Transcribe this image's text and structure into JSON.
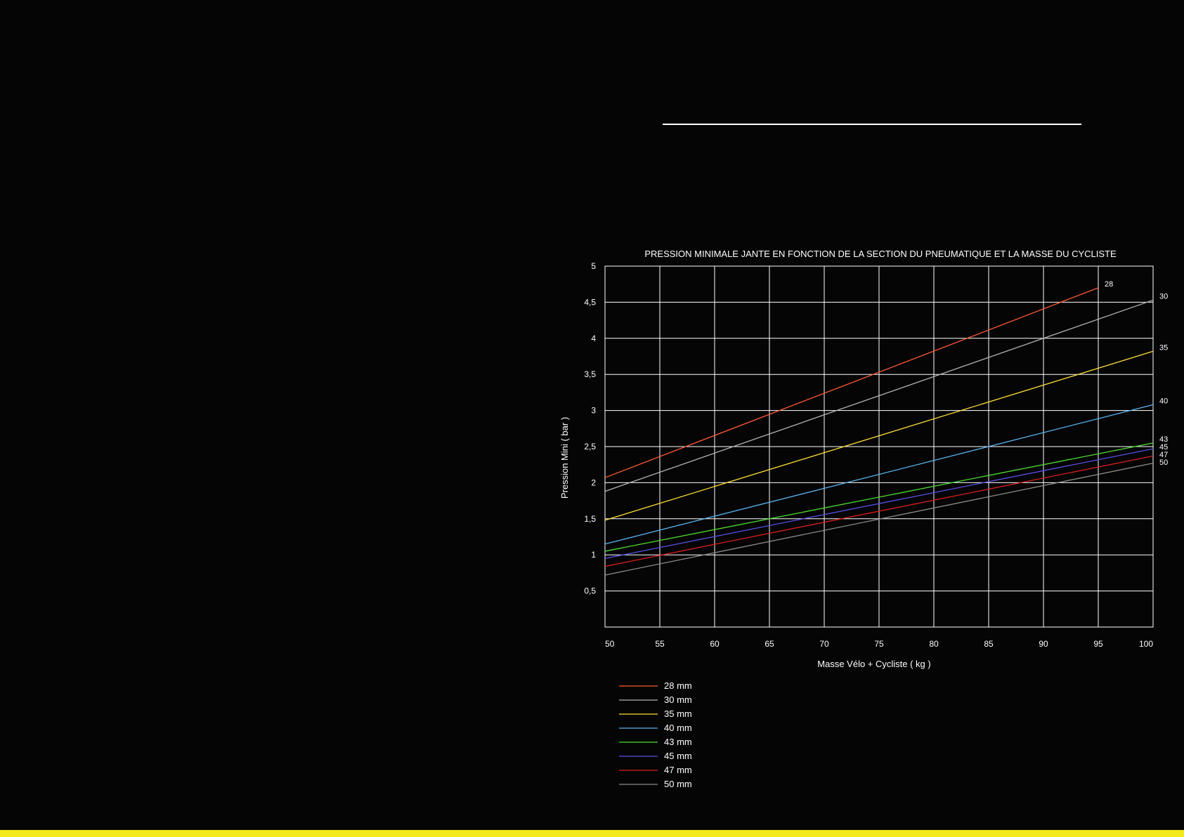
{
  "chart_data": {
    "type": "line",
    "title": "PRESSION MINIMALE JANTE EN FONCTION DE LA SECTION DU PNEUMATIQUE ET LA MASSE DU CYCLISTE",
    "xlabel": "Masse Vélo + Cycliste ( kg )",
    "ylabel": "Pression Mini ( bar )",
    "xlim": [
      50,
      100
    ],
    "ylim": [
      0,
      5
    ],
    "x_ticks": [
      {
        "value": 50,
        "label": "50"
      },
      {
        "value": 55,
        "label": "55"
      },
      {
        "value": 60,
        "label": "60"
      },
      {
        "value": 65,
        "label": "65"
      },
      {
        "value": 70,
        "label": "70"
      },
      {
        "value": 75,
        "label": "75"
      },
      {
        "value": 80,
        "label": "80"
      },
      {
        "value": 85,
        "label": "85"
      },
      {
        "value": 90,
        "label": "90"
      },
      {
        "value": 95,
        "label": "95"
      },
      {
        "value": 100,
        "label": "100"
      }
    ],
    "y_ticks": [
      {
        "value": 0.5,
        "label": "0,5"
      },
      {
        "value": 1,
        "label": "1"
      },
      {
        "value": 1.5,
        "label": "1,5"
      },
      {
        "value": 2,
        "label": "2"
      },
      {
        "value": 2.5,
        "label": "2,5"
      },
      {
        "value": 3,
        "label": "3"
      },
      {
        "value": 3.5,
        "label": "3,5"
      },
      {
        "value": 4,
        "label": "4"
      },
      {
        "value": 4.5,
        "label": "4,5"
      },
      {
        "value": 5,
        "label": "5"
      }
    ],
    "grid": true,
    "legend_position": "bottom-left",
    "series": [
      {
        "name": "28 mm",
        "end_label": "28",
        "color": "#ff5a36",
        "x": [
          50,
          95
        ],
        "y": [
          2.07,
          4.7
        ]
      },
      {
        "name": "30 mm",
        "end_label": "30",
        "color": "#b4b4b4",
        "x": [
          50,
          100
        ],
        "y": [
          1.88,
          4.53
        ]
      },
      {
        "name": "35 mm",
        "end_label": "35",
        "color": "#ffe03a",
        "x": [
          50,
          100
        ],
        "y": [
          1.48,
          3.82
        ]
      },
      {
        "name": "40 mm",
        "end_label": "40",
        "color": "#5ab4f0",
        "x": [
          50,
          100
        ],
        "y": [
          1.15,
          3.08
        ]
      },
      {
        "name": "43 mm",
        "end_label": "43",
        "color": "#4edc32",
        "x": [
          50,
          100
        ],
        "y": [
          1.05,
          2.55
        ]
      },
      {
        "name": "45 mm",
        "end_label": "45",
        "color": "#5a4ee6",
        "x": [
          50,
          100
        ],
        "y": [
          0.95,
          2.47
        ]
      },
      {
        "name": "47 mm",
        "end_label": "47",
        "color": "#dc1e1e",
        "x": [
          50,
          100
        ],
        "y": [
          0.84,
          2.37
        ]
      },
      {
        "name": "50 mm",
        "end_label": "50",
        "color": "#8c8c8c",
        "x": [
          50,
          100
        ],
        "y": [
          0.72,
          2.27
        ]
      }
    ]
  }
}
